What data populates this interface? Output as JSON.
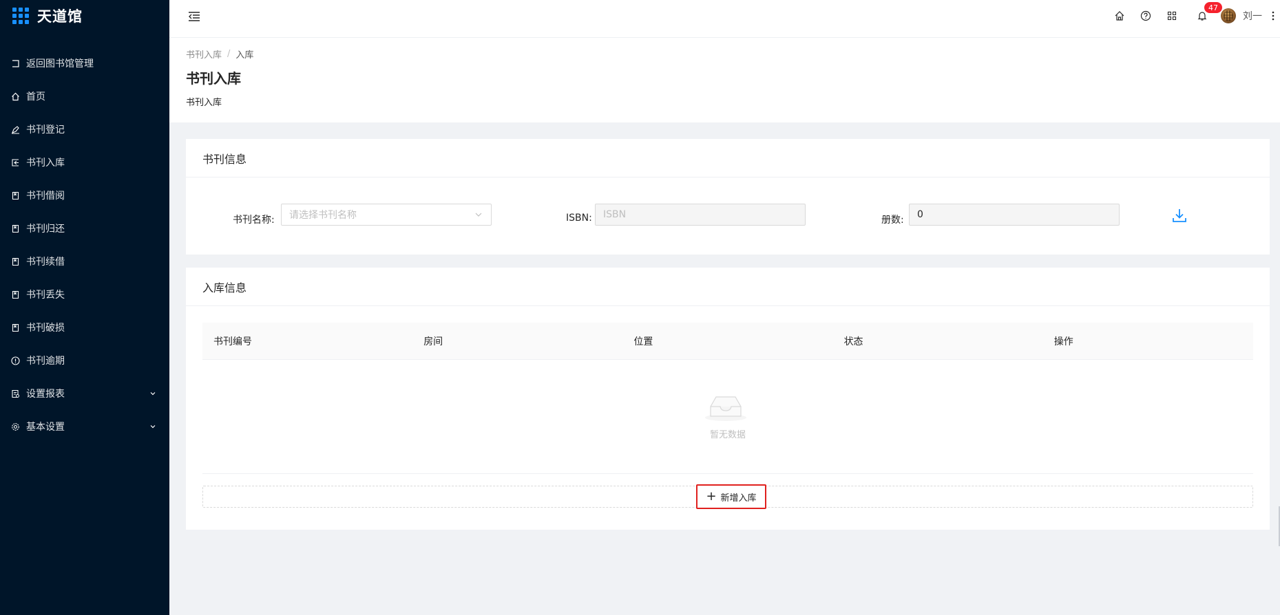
{
  "app": {
    "title": "天道馆"
  },
  "sidebar": {
    "items": [
      {
        "label": "返回图书馆管理",
        "icon": "return-icon"
      },
      {
        "label": "首页",
        "icon": "home-icon"
      },
      {
        "label": "书刊登记",
        "icon": "pen-icon"
      },
      {
        "label": "书刊入库",
        "icon": "import-icon"
      },
      {
        "label": "书刊借阅",
        "icon": "book-icon"
      },
      {
        "label": "书刊归还",
        "icon": "book-icon"
      },
      {
        "label": "书刊续借",
        "icon": "book-icon"
      },
      {
        "label": "书刊丢失",
        "icon": "book-icon"
      },
      {
        "label": "书刊破损",
        "icon": "book-icon"
      },
      {
        "label": "书刊逾期",
        "icon": "exclamation-circle-icon"
      },
      {
        "label": "设置报表",
        "icon": "report-icon",
        "expandable": true
      },
      {
        "label": "基本设置",
        "icon": "gear-icon",
        "expandable": true
      }
    ]
  },
  "header": {
    "notification_count": "47",
    "user_name": "刘一"
  },
  "page": {
    "breadcrumb": [
      "书刊入库",
      "入库"
    ],
    "breadcrumb_sep": "/",
    "title": "书刊入库",
    "description": "书刊入库"
  },
  "book_info": {
    "title": "书刊信息",
    "name_label": "书刊名称:",
    "name_placeholder": "请选择书刊名称",
    "isbn_label": "ISBN:",
    "isbn_placeholder": "ISBN",
    "count_label": "册数:",
    "count_value": "0"
  },
  "storage_info": {
    "title": "入库信息",
    "columns": [
      "书刊编号",
      "房间",
      "位置",
      "状态",
      "操作"
    ],
    "empty_text": "暂无数据",
    "add_button": "新增入库"
  },
  "colors": {
    "sidebar_bg": "#001529",
    "primary": "#1890ff",
    "badge": "#f5222d",
    "highlight_border": "#e0201e"
  }
}
